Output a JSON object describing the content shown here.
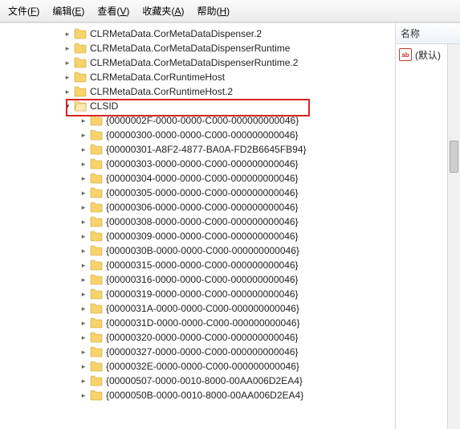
{
  "menu": {
    "file": {
      "text": "文件",
      "mn": "F"
    },
    "edit": {
      "text": "编辑",
      "mn": "E"
    },
    "view": {
      "text": "查看",
      "mn": "V"
    },
    "fav": {
      "text": "收藏夹",
      "mn": "A"
    },
    "help": {
      "text": "帮助",
      "mn": "H"
    }
  },
  "tree": {
    "top": [
      "CLRMetaData.CorMetaDataDispenser.2",
      "CLRMetaData.CorMetaDataDispenserRuntime",
      "CLRMetaData.CorMetaDataDispenserRuntime.2",
      "CLRMetaData.CorRuntimeHost",
      "CLRMetaData.CorRuntimeHost.2"
    ],
    "clsid_label": "CLSID",
    "clsid_children": [
      "{0000002F-0000-0000-C000-000000000046}",
      "{00000300-0000-0000-C000-000000000046}",
      "{00000301-A8F2-4877-BA0A-FD2B6645FB94}",
      "{00000303-0000-0000-C000-000000000046}",
      "{00000304-0000-0000-C000-000000000046}",
      "{00000305-0000-0000-C000-000000000046}",
      "{00000306-0000-0000-C000-000000000046}",
      "{00000308-0000-0000-C000-000000000046}",
      "{00000309-0000-0000-C000-000000000046}",
      "{0000030B-0000-0000-C000-000000000046}",
      "{00000315-0000-0000-C000-000000000046}",
      "{00000316-0000-0000-C000-000000000046}",
      "{00000319-0000-0000-C000-000000000046}",
      "{0000031A-0000-0000-C000-000000000046}",
      "{0000031D-0000-0000-C000-000000000046}",
      "{00000320-0000-0000-C000-000000000046}",
      "{00000327-0000-0000-C000-000000000046}",
      "{0000032E-0000-0000-C000-000000000046}",
      "{00000507-0000-0010-8000-00AA006D2EA4}",
      "{0000050B-0000-0010-8000-00AA006D2EA4}"
    ]
  },
  "rightpane": {
    "header": "名称",
    "default_value_label": "(默认)"
  },
  "icons": {
    "ab": "ab"
  }
}
